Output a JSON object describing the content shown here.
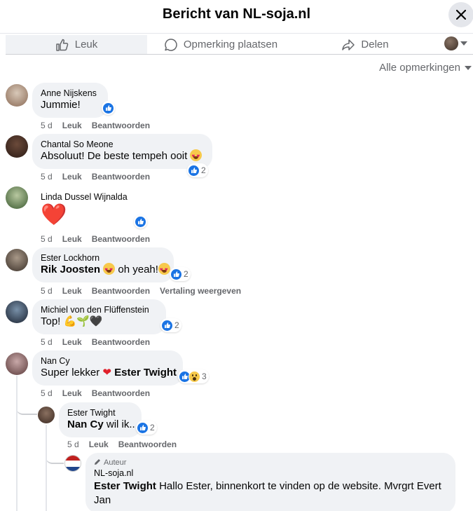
{
  "header": {
    "title": "Bericht van NL-soja.nl"
  },
  "actions": {
    "like": "Leuk",
    "comment": "Opmerking plaatsen",
    "share": "Delen"
  },
  "filter": {
    "label": "Alle opmerkingen"
  },
  "meta": {
    "time": "5 d",
    "like": "Leuk",
    "reply": "Beantwoorden",
    "translate": "Vertaling weergeven"
  },
  "comments": [
    {
      "author": "Anne Nijskens",
      "text": "Jummie!",
      "reactions": ""
    },
    {
      "author": "Chantal So Meone",
      "text": "Absoluut! De beste tempeh ooit",
      "reactions": "2"
    },
    {
      "author": "Linda Dussel Wijnalda",
      "text": "❤️",
      "reactions": ""
    },
    {
      "author": "Ester Lockhorn",
      "mention": "Rik Joosten",
      "text": " oh yeah!",
      "reactions": "2"
    },
    {
      "author": "Michiel von den Flüffenstein",
      "text": "Top! 💪🌱🖤",
      "reactions": "2"
    },
    {
      "author": "Nan Cy",
      "text": "Super lekker",
      "mention": "Ester Twight",
      "reactions": "3"
    }
  ],
  "replies": [
    {
      "author": "Ester Twight",
      "mention": "Nan Cy",
      "text": " wil ik..",
      "reactions": "2"
    },
    {
      "badge": "Auteur",
      "author": "NL-soja.nl",
      "mention": "Ester Twight",
      "text_line1": " Hallo Ester, binnenkort te vinden op de website. Mvrgrt Evert",
      "text_line2": "Jan"
    }
  ],
  "colors": {
    "accent": "#1b74e4",
    "bubble": "#f0f2f5",
    "muted": "#65676b"
  }
}
